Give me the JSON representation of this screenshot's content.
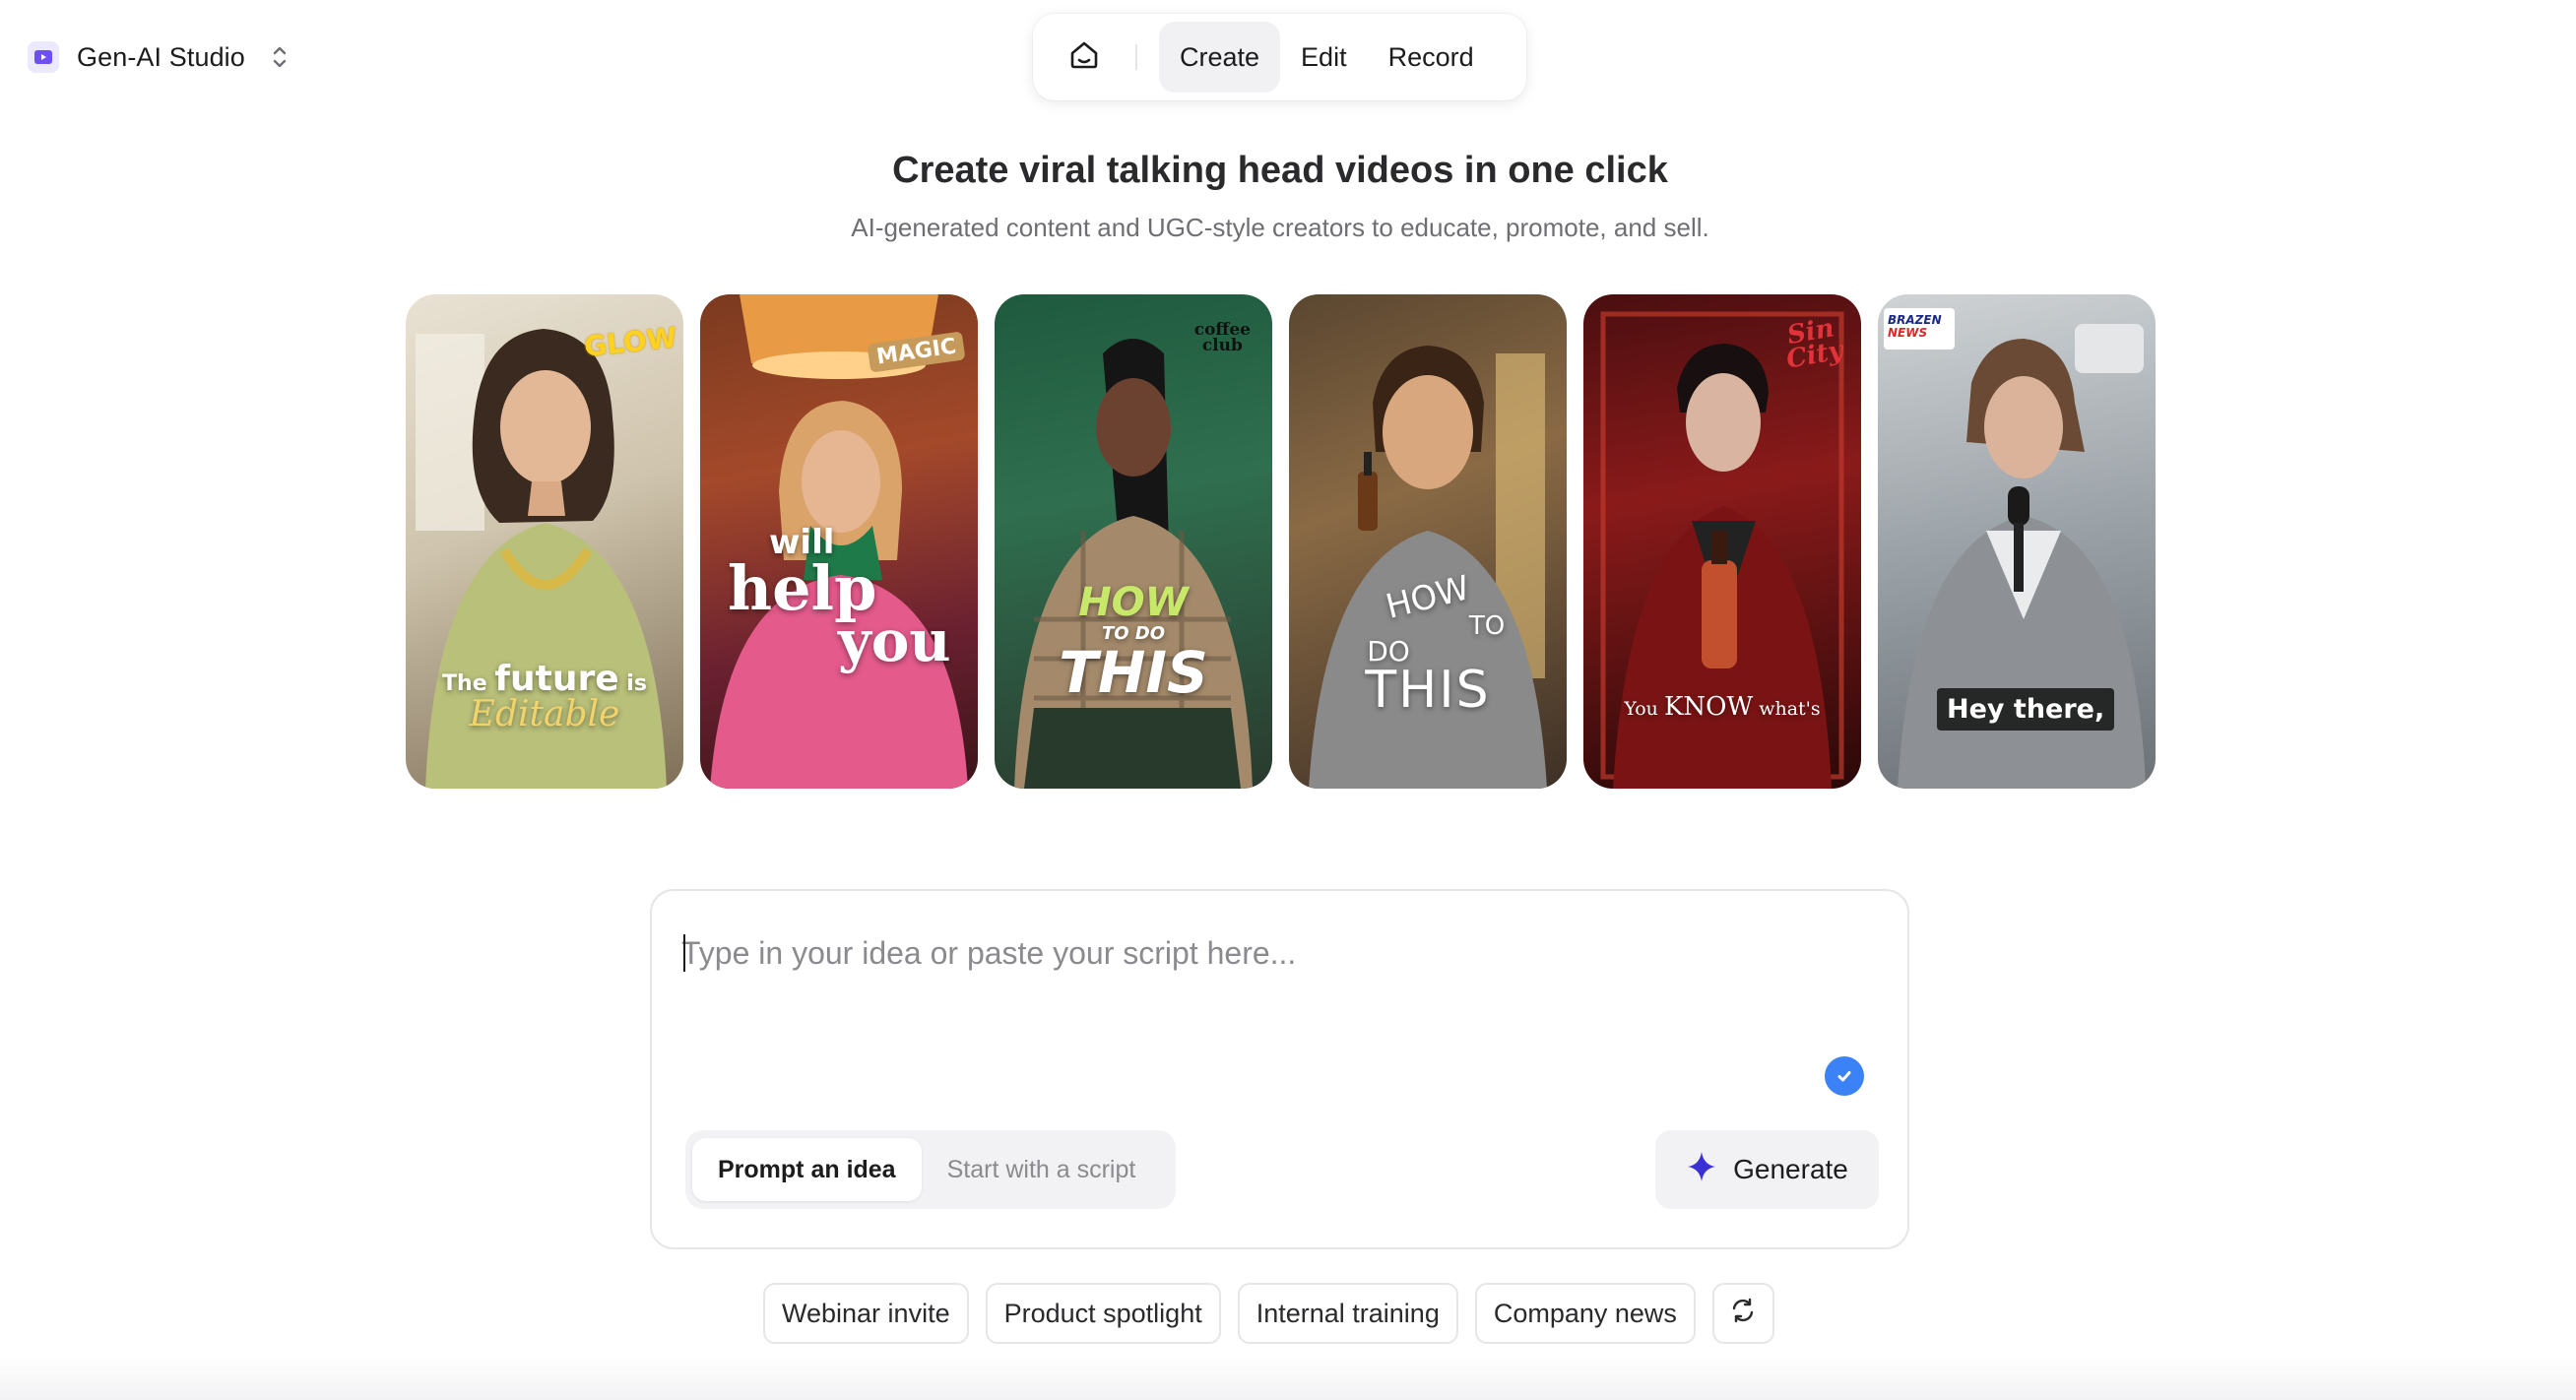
{
  "workspace": {
    "name": "Gen-AI Studio",
    "logo_icon": "play-square-icon",
    "switch_icon": "chevron-up-down-icon"
  },
  "nav": {
    "home_icon": "home-icon",
    "tabs": [
      {
        "label": "Create",
        "active": true
      },
      {
        "label": "Edit",
        "active": false
      },
      {
        "label": "Record",
        "active": false
      }
    ]
  },
  "hero": {
    "title": "Create viral talking head videos in one click",
    "subtitle": "AI-generated content and UGC-style creators to educate, promote, and sell."
  },
  "cards": [
    {
      "badge": "GLOW",
      "caption_line1": "The future is",
      "caption_line2": "Editable",
      "caption_emph": "future",
      "caption_pre": "The",
      "caption_post": "is"
    },
    {
      "badge": "MAGIC",
      "caption_line1": "will",
      "caption_line2": "help",
      "caption_line3": "you"
    },
    {
      "badge_line1": "coffee",
      "badge_line2": "club",
      "caption_line1": "HOW",
      "caption_line2": "TO DO",
      "caption_line3": "THIS"
    },
    {
      "caption_line1": "HOW",
      "caption_line2": "TO",
      "caption_line3": "DO",
      "caption_line4": "THIS"
    },
    {
      "badge_line1": "Sin",
      "badge_line2": "City",
      "caption_pre": "You",
      "caption_emph": "KNOW",
      "caption_post": "what's"
    },
    {
      "badge_line1": "BRAZEN",
      "badge_line2": "NEWS",
      "caption_line1": "Hey there,"
    }
  ],
  "prompt": {
    "placeholder": "Type in your idea or paste your script here...",
    "value": "",
    "check_icon": "check-circle-icon",
    "modes": [
      {
        "label": "Prompt an idea",
        "active": true
      },
      {
        "label": "Start with a script",
        "active": false
      }
    ],
    "generate_label": "Generate",
    "generate_icon": "sparkle-icon"
  },
  "suggestions": [
    "Webinar invite",
    "Product spotlight",
    "Internal training",
    "Company news"
  ],
  "refresh_icon": "refresh-icon",
  "colors": {
    "accent": "#3b82f6",
    "logo": "#6d4ff5",
    "sparkle": "#3b30d6"
  }
}
